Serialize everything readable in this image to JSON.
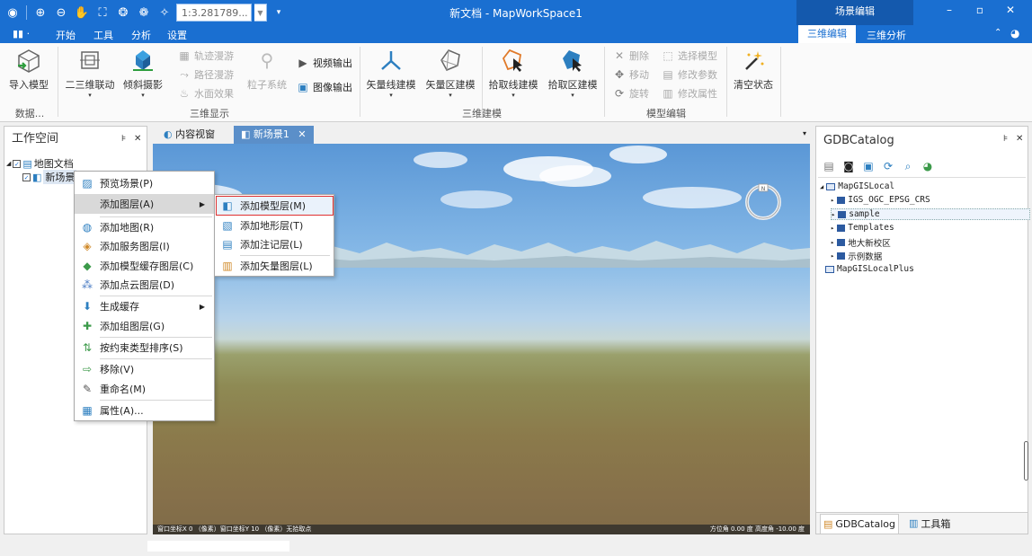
{
  "titlebar": {
    "title": "新文档 - MapWorkSpace1",
    "scale_value": "1:3.281789...",
    "context_tab_group": "场景编辑"
  },
  "menu": {
    "app_button": "▮▮ ·",
    "items": [
      "开始",
      "工具",
      "分析",
      "设置"
    ],
    "context_tabs": [
      "三维编辑",
      "三维分析"
    ]
  },
  "ribbon": {
    "import_model": "导入模型",
    "group_data": "数据...",
    "linkage_2d3d": "二三维联动",
    "oblique_photo": "倾斜摄影",
    "track_roam": "轨迹漫游",
    "path_roam": "路径漫游",
    "water_effect": "水面效果",
    "particle_system": "粒子系统",
    "video_output": "视频输出",
    "image_output": "图像输出",
    "group_3d_display": "三维显示",
    "vector_line_model": "矢量线建模",
    "vector_area_model": "矢量区建模",
    "pick_line_model": "拾取线建模",
    "pick_area_model": "拾取区建模",
    "group_3d_modeling": "三维建模",
    "delete": "删除",
    "move": "移动",
    "rotate": "旋转",
    "select_model": "选择模型",
    "edit_params": "修改参数",
    "edit_attrs": "修改属性",
    "group_model_edit": "模型编辑",
    "clear_state": "清空状态"
  },
  "left_panel": {
    "title": "工作空间",
    "tree": [
      "地图文档",
      "新场景"
    ]
  },
  "doc_tabs": [
    "内容视窗",
    "新场景1"
  ],
  "context_menu": {
    "items": [
      "预览场景(P)",
      "添加图层(A)",
      "添加地图(R)",
      "添加服务图层(I)",
      "添加模型缓存图层(C)",
      "添加点云图层(D)",
      "生成缓存",
      "添加组图层(G)",
      "按约束类型排序(S)",
      "移除(V)",
      "重命名(M)",
      "属性(A)..."
    ]
  },
  "submenu": {
    "items": [
      "添加模型层(M)",
      "添加地形层(T)",
      "添加注记层(L)",
      "添加矢量图层(L)"
    ]
  },
  "scene_status": {
    "left": "窗口坐标X 0  （像素）窗口坐标Y 10  （像素）无拾取点",
    "right": "方位角    0.00 度  高度角  -10.00 度"
  },
  "right_panel": {
    "title": "GDBCatalog",
    "tree": [
      "MapGISLocal",
      "IGS_OGC_EPSG_CRS",
      "sample",
      "Templates",
      "地大新校区",
      "示例数据",
      "MapGISLocalPlus"
    ],
    "bottom_tabs": [
      "GDBCatalog",
      "工具箱"
    ]
  },
  "colors": {
    "titlebar": "#1a6fd1",
    "highlight_border": "#e03030"
  }
}
